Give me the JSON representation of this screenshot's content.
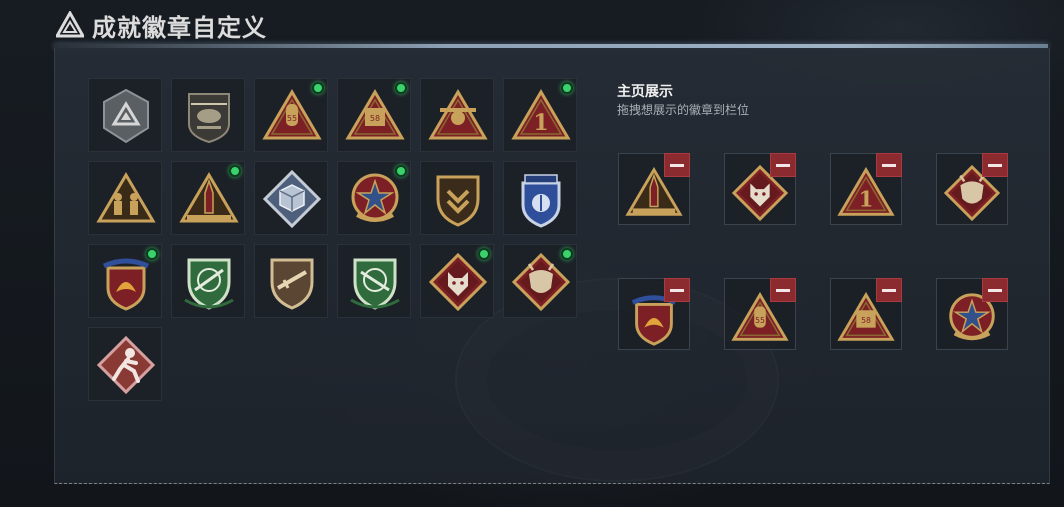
{
  "header": {
    "title": "成就徽章自定义",
    "icon": "triangle-logo-icon"
  },
  "showcase": {
    "title": "主页展示",
    "subtitle": "拖拽想展示的徽章到栏位"
  },
  "colors": {
    "accent_green": "#3ad36b",
    "remove_red": "#8b2a2f",
    "gold": "#c8a25a",
    "dark_red": "#7d2025"
  },
  "badges": [
    {
      "icon": "triangle-emblem-gray-badge",
      "equipped": false
    },
    {
      "icon": "helicopter-badge",
      "equipped": false
    },
    {
      "icon": "rocket-55-triangle-badge",
      "equipped": true
    },
    {
      "icon": "vehicle-58-triangle-badge",
      "equipped": true
    },
    {
      "icon": "bomber-triangle-badge",
      "equipped": false
    },
    {
      "icon": "number-1-triangle-badge",
      "equipped": true
    },
    {
      "icon": "soldiers-triangle-badge",
      "equipped": false
    },
    {
      "icon": "missile-triangle-badge",
      "equipped": true
    },
    {
      "icon": "cube-diamond-badge",
      "equipped": false
    },
    {
      "icon": "star-medal-badge",
      "equipped": true
    },
    {
      "icon": "chevron-shield-badge",
      "equipped": false
    },
    {
      "icon": "blue-crest-badge",
      "equipped": false
    },
    {
      "icon": "phoenix-crest-badge",
      "equipped": true
    },
    {
      "icon": "green-rifle-shield-badge",
      "equipped": false
    },
    {
      "icon": "brown-rifle-shield-badge",
      "equipped": false
    },
    {
      "icon": "green-rifle-shield-alt-badge",
      "equipped": false
    },
    {
      "icon": "wolf-diamond-badge",
      "equipped": true
    },
    {
      "icon": "dragon-diamond-badge",
      "equipped": true
    },
    {
      "icon": "runner-diamond-badge",
      "equipped": false
    }
  ],
  "showcase_slots": [
    {
      "icon": "missile-triangle-badge"
    },
    {
      "icon": "wolf-diamond-badge"
    },
    {
      "icon": "number-1-triangle-badge"
    },
    {
      "icon": "dragon-diamond-badge"
    },
    {
      "icon": "phoenix-crest-badge"
    },
    {
      "icon": "rocket-55-triangle-badge"
    },
    {
      "icon": "vehicle-58-triangle-badge"
    },
    {
      "icon": "star-medal-badge"
    }
  ]
}
